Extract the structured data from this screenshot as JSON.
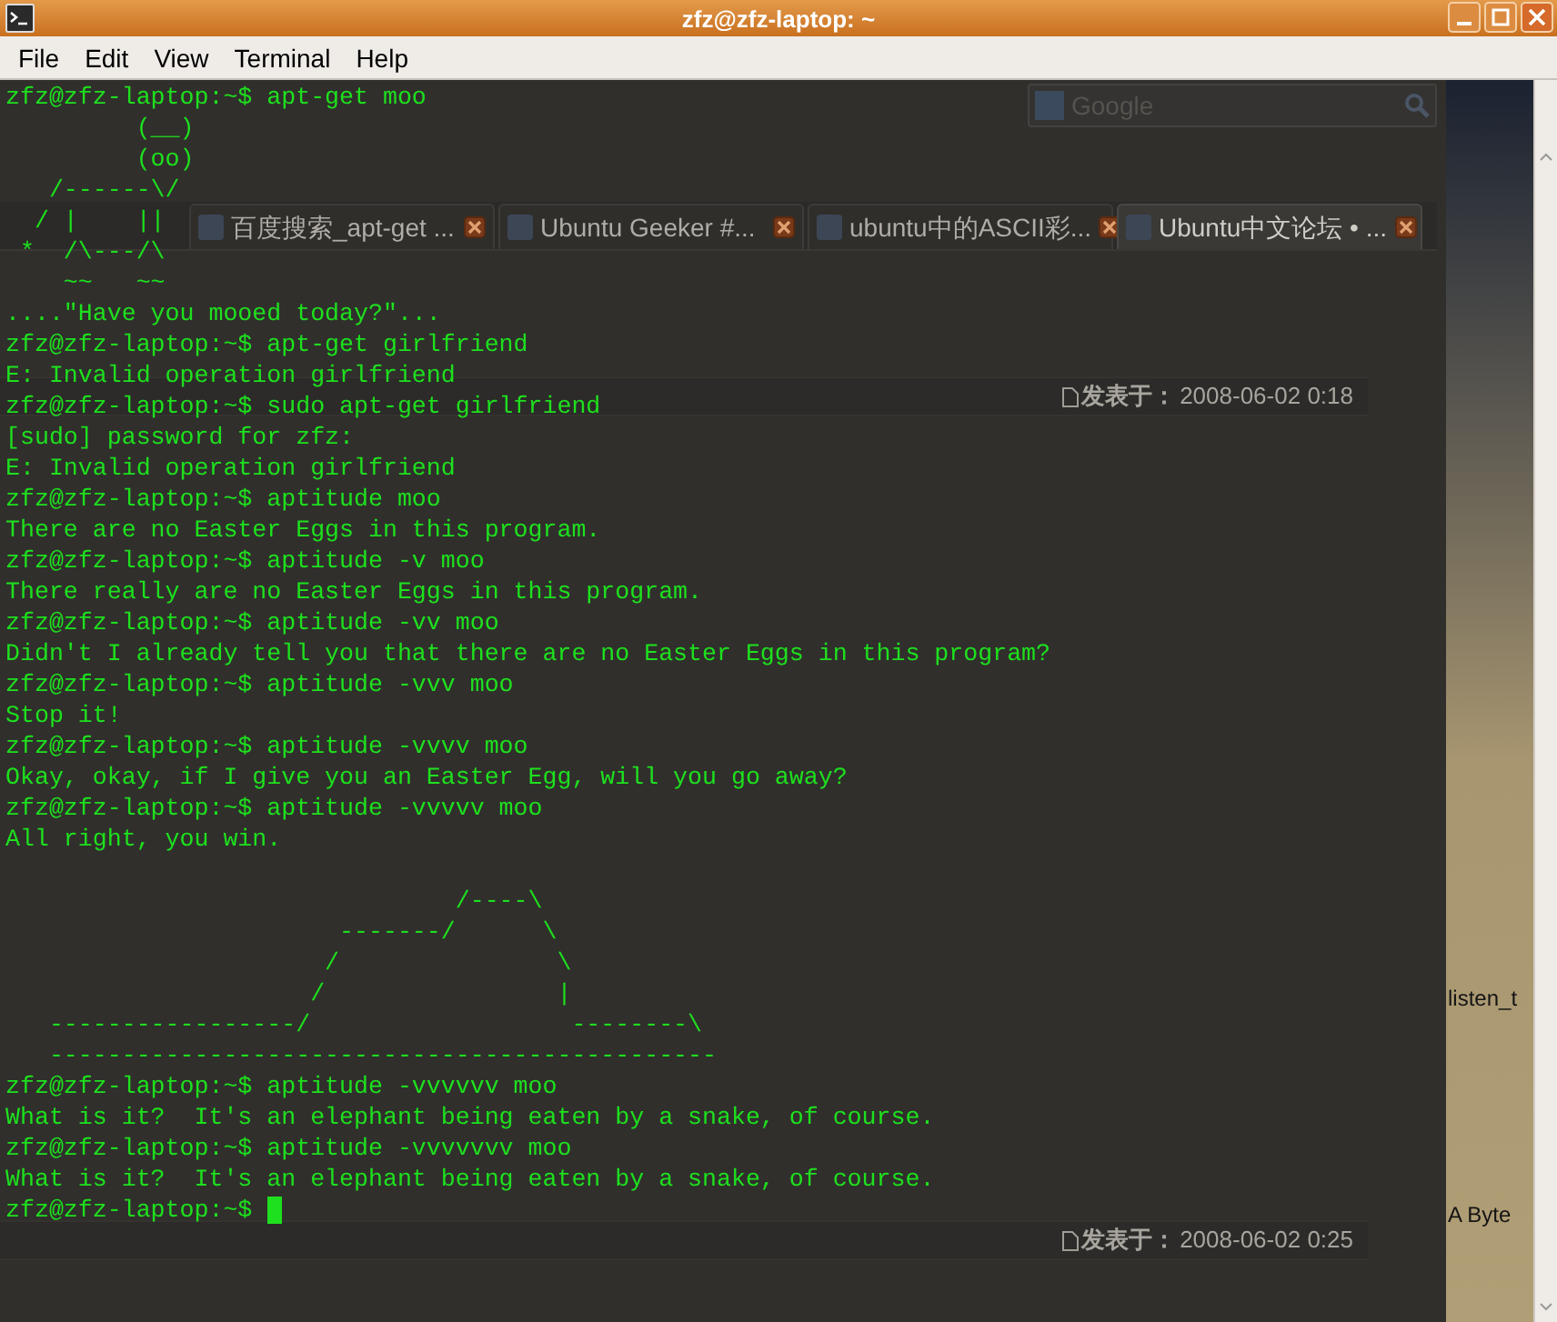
{
  "window": {
    "title": "zfz@zfz-laptop: ~"
  },
  "menu": [
    "File",
    "Edit",
    "View",
    "Terminal",
    "Help"
  ],
  "background_browser": {
    "search": {
      "placeholder": "Google"
    },
    "tabs": [
      {
        "label": "百度搜索_apt-get ...",
        "selected": false
      },
      {
        "label": "Ubuntu Geeker #...",
        "selected": false
      },
      {
        "label": "ubuntu中的ASCII彩...",
        "selected": false
      },
      {
        "label": "Ubuntu中文论坛 • ...",
        "selected": true
      }
    ],
    "posts": [
      {
        "label": "发表于：",
        "time": "2008-06-02 0:18"
      },
      {
        "label": "发表于：",
        "time": "2008-06-02 0:25"
      }
    ]
  },
  "desktop": {
    "icon_labels": [
      "listen_t",
      "A Byte"
    ]
  },
  "terminal": {
    "cursor_visible": true,
    "lines": [
      {
        "kind": "text",
        "text": "zfz@zfz-laptop:~$ apt-get moo"
      },
      {
        "kind": "text",
        "text": "         (__)"
      },
      {
        "kind": "text",
        "text": "         (oo)"
      },
      {
        "kind": "text",
        "text": "   /------\\/"
      },
      {
        "kind": "text",
        "text": "  / |    ||"
      },
      {
        "kind": "text",
        "text": " *  /\\---/\\"
      },
      {
        "kind": "text",
        "text": "    ~~   ~~"
      },
      {
        "kind": "text",
        "text": "....\"Have you mooed today?\"..."
      },
      {
        "kind": "text",
        "text": "zfz@zfz-laptop:~$ apt-get girlfriend"
      },
      {
        "kind": "text",
        "text": "E: Invalid operation girlfriend"
      },
      {
        "kind": "text",
        "text": "zfz@zfz-laptop:~$ sudo apt-get girlfriend"
      },
      {
        "kind": "text",
        "text": "[sudo] password for zfz:"
      },
      {
        "kind": "text",
        "text": "E: Invalid operation girlfriend"
      },
      {
        "kind": "text",
        "text": "zfz@zfz-laptop:~$ aptitude moo"
      },
      {
        "kind": "text",
        "text": "There are no Easter Eggs in this program."
      },
      {
        "kind": "text",
        "text": "zfz@zfz-laptop:~$ aptitude -v moo"
      },
      {
        "kind": "text",
        "text": "There really are no Easter Eggs in this program."
      },
      {
        "kind": "text",
        "text": "zfz@zfz-laptop:~$ aptitude -vv moo"
      },
      {
        "kind": "text",
        "text": "Didn't I already tell you that there are no Easter Eggs in this program?"
      },
      {
        "kind": "text",
        "text": "zfz@zfz-laptop:~$ aptitude -vvv moo"
      },
      {
        "kind": "text",
        "text": "Stop it!"
      },
      {
        "kind": "text",
        "text": "zfz@zfz-laptop:~$ aptitude -vvvv moo"
      },
      {
        "kind": "text",
        "text": "Okay, okay, if I give you an Easter Egg, will you go away?"
      },
      {
        "kind": "text",
        "text": "zfz@zfz-laptop:~$ aptitude -vvvvv moo"
      },
      {
        "kind": "text",
        "text": "All right, you win."
      },
      {
        "kind": "blank"
      },
      {
        "kind": "text",
        "text": "                               /----\\"
      },
      {
        "kind": "text",
        "text": "                       -------/      \\"
      },
      {
        "kind": "text",
        "text": "                      /               \\"
      },
      {
        "kind": "text",
        "text": "                     /                |"
      },
      {
        "kind": "text",
        "text": "   -----------------/                  --------\\"
      },
      {
        "kind": "text",
        "text": "   ----------------------------------------------"
      },
      {
        "kind": "text",
        "text": "zfz@zfz-laptop:~$ aptitude -vvvvvv moo"
      },
      {
        "kind": "text",
        "text": "What is it?  It's an elephant being eaten by a snake, of course."
      },
      {
        "kind": "text",
        "text": "zfz@zfz-laptop:~$ aptitude -vvvvvvv moo"
      },
      {
        "kind": "text",
        "text": "What is it?  It's an elephant being eaten by a snake, of course."
      },
      {
        "kind": "prompt",
        "text": "zfz@zfz-laptop:~$ "
      }
    ]
  }
}
